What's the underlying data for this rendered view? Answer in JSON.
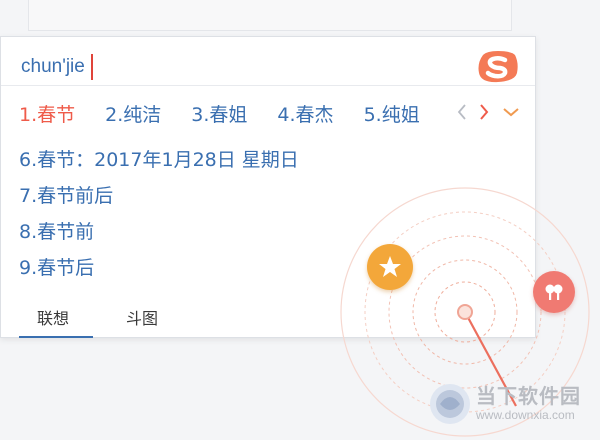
{
  "composition": {
    "text": "chun'jie"
  },
  "candidates": [
    {
      "label": "1.春节"
    },
    {
      "label": "2.纯洁"
    },
    {
      "label": "3.春姐"
    },
    {
      "label": "4.春杰"
    },
    {
      "label": "5.纯姐"
    }
  ],
  "more_candidates": [
    {
      "label": "6.春节：2017年1月28日  星期日"
    },
    {
      "label": "7.春节前后"
    },
    {
      "label": "8.春节前"
    },
    {
      "label": "9.春节后"
    }
  ],
  "tabs": [
    {
      "label": "联想",
      "active": true
    },
    {
      "label": "斗图",
      "active": false
    }
  ],
  "watermark": {
    "title": "当下软件园",
    "url": "www.downxia.com"
  },
  "colors": {
    "candidate": "#3a6fb0",
    "selected": "#ef5b4a",
    "logo": "#f47a56",
    "star": "#f3a73a",
    "mic": "#f07a72"
  },
  "icons": {
    "logo": "sogou-logo-icon",
    "prev": "chevron-left-icon",
    "next": "chevron-right-icon",
    "expand": "chevron-down-icon",
    "star": "star-icon",
    "mic": "microphone-icon"
  }
}
